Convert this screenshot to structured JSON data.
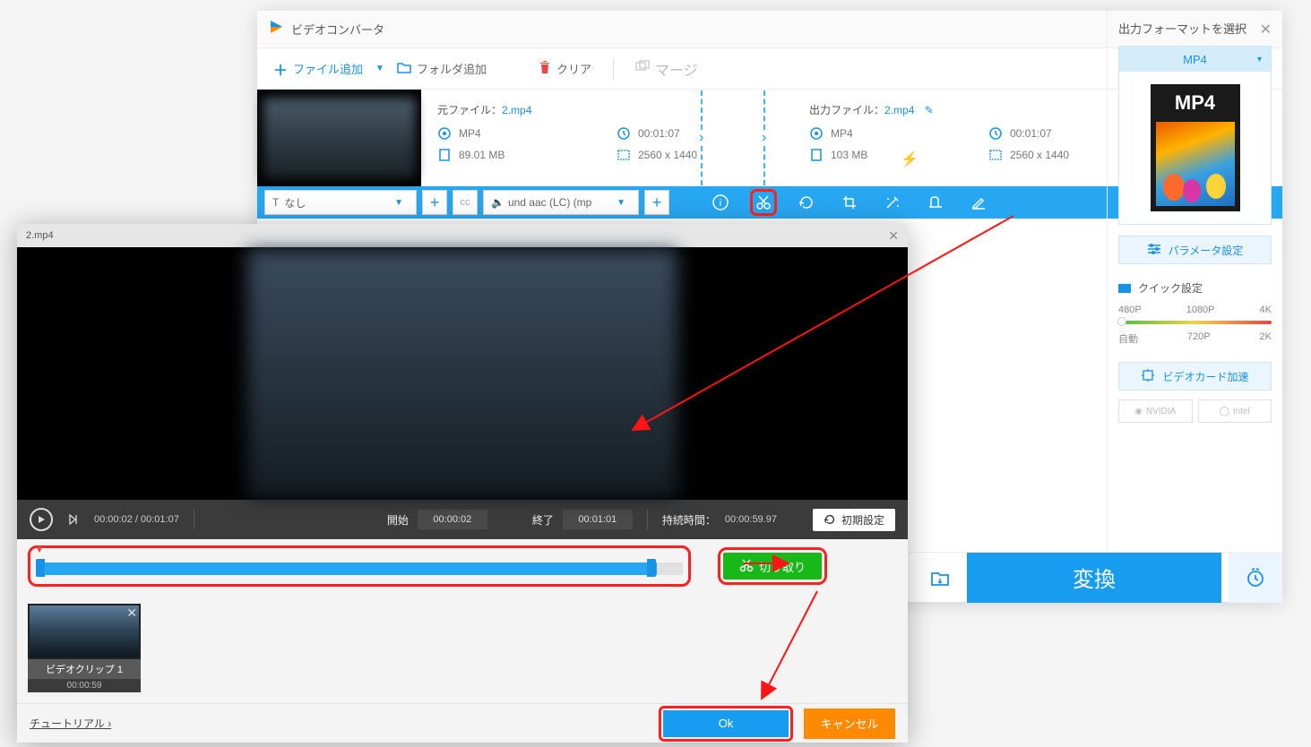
{
  "app": {
    "title": "ビデオコンバータ"
  },
  "toolbar": {
    "add_file": "ファイル追加",
    "add_folder": "フォルダ追加",
    "clear": "クリア",
    "merge": "マージ"
  },
  "file_info": {
    "source_label": "元ファイル：",
    "source_name": "2.mp4",
    "output_label": "出力ファイル：",
    "output_name": "2.mp4",
    "src_format": "MP4",
    "src_duration": "00:01:07",
    "src_size": "89.01 MB",
    "src_res": "2560 x 1440",
    "out_format": "MP4",
    "out_duration": "00:01:07",
    "out_size": "103 MB",
    "out_res": "2560 x 1440"
  },
  "action_bar": {
    "subtitle_select": "なし",
    "audio_select": "und aac (LC) (mp"
  },
  "sidebar": {
    "title": "出力フォーマットを選択",
    "format_btn": "MP4",
    "format_card": "MP4",
    "param": "パラメータ設定",
    "quick_label": "クイック設定",
    "quality": {
      "p480": "480P",
      "p1080": "1080P",
      "k4": "4K",
      "auto": "自動",
      "p720": "720P",
      "k2": "2K"
    },
    "gpu": "ビデオカード加速",
    "gpu_chips": {
      "nvidia": "NVIDIA",
      "intel": "Intel"
    }
  },
  "convert": {
    "label": "変換"
  },
  "editor": {
    "filename": "2.mp4",
    "time_current": "00:00:02",
    "time_total": "00:01:07",
    "start_label": "開始",
    "start_value": "00:00:02",
    "end_label": "終了",
    "end_value": "00:01:01",
    "duration_label": "持続時間：",
    "duration_value": "00:00:59.97",
    "reset": "初期設定",
    "cut": "切り取り",
    "clip": {
      "label": "ビデオクリップ 1",
      "time": "00:00:59"
    },
    "tutorial": "チュートリアル ›",
    "ok": "Ok",
    "cancel": "キャンセル"
  }
}
